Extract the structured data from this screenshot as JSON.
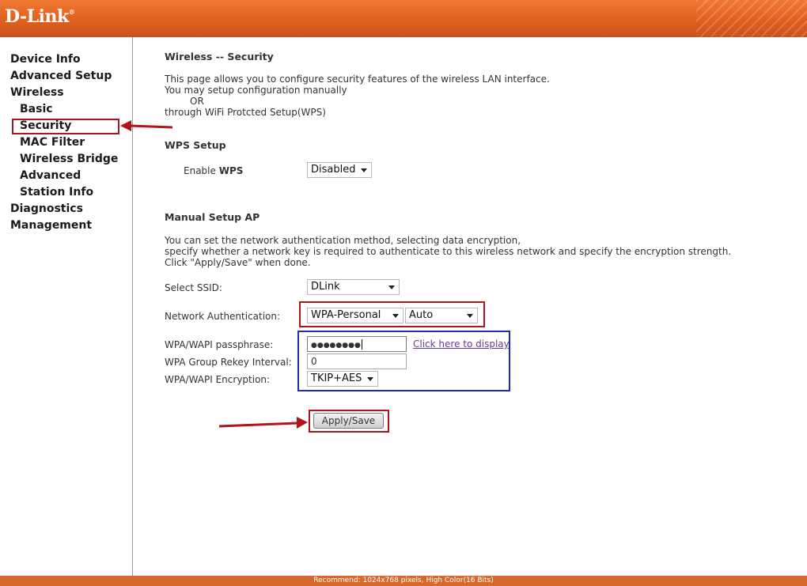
{
  "header": {
    "logo": "D-Link",
    "logo_mark": "®"
  },
  "sidebar": {
    "items": [
      {
        "label": "Device Info"
      },
      {
        "label": "Advanced Setup"
      },
      {
        "label": "Wireless"
      },
      {
        "label": "Basic"
      },
      {
        "label": "Security"
      },
      {
        "label": "MAC Filter"
      },
      {
        "label": "Wireless Bridge"
      },
      {
        "label": "Advanced"
      },
      {
        "label": "Station Info"
      },
      {
        "label": "Diagnostics"
      },
      {
        "label": "Management"
      }
    ]
  },
  "main": {
    "title": "Wireless -- Security",
    "intro": [
      "This page allows you to configure security features of the wireless LAN interface.",
      "You may setup configuration manually",
      "OR",
      "through WiFi Protcted Setup(WPS)"
    ],
    "wps": {
      "heading": "WPS Setup",
      "enable_label_prefix": "Enable ",
      "enable_label_strong": "WPS",
      "enable_value": "Disabled"
    },
    "manual": {
      "heading": "Manual Setup AP",
      "desc": [
        "You can set the network authentication method, selecting data encryption,",
        "specify whether a network key is required to authenticate to this wireless network and specify the encryption strength.",
        "Click \"Apply/Save\" when done."
      ],
      "ssid_label": "Select SSID:",
      "ssid_value": "DLink",
      "auth_label": "Network Authentication:",
      "auth_value": "WPA-Personal",
      "auth_mode_value": "Auto",
      "passphrase_label": "WPA/WAPI passphrase:",
      "passphrase_value": "●●●●●●●●",
      "display_link": "Click here to display",
      "rekey_label": "WPA Group Rekey Interval:",
      "rekey_value": "0",
      "encryption_label": "WPA/WAPI Encryption:",
      "encryption_value": "TKIP+AES"
    },
    "apply_label": "Apply/Save"
  },
  "annotations": {
    "red": "#b0151b",
    "blue": "#1f2bb5"
  },
  "footer": {
    "text": "Recommend: 1024x768 pixels, High Color(16 Bits)"
  }
}
